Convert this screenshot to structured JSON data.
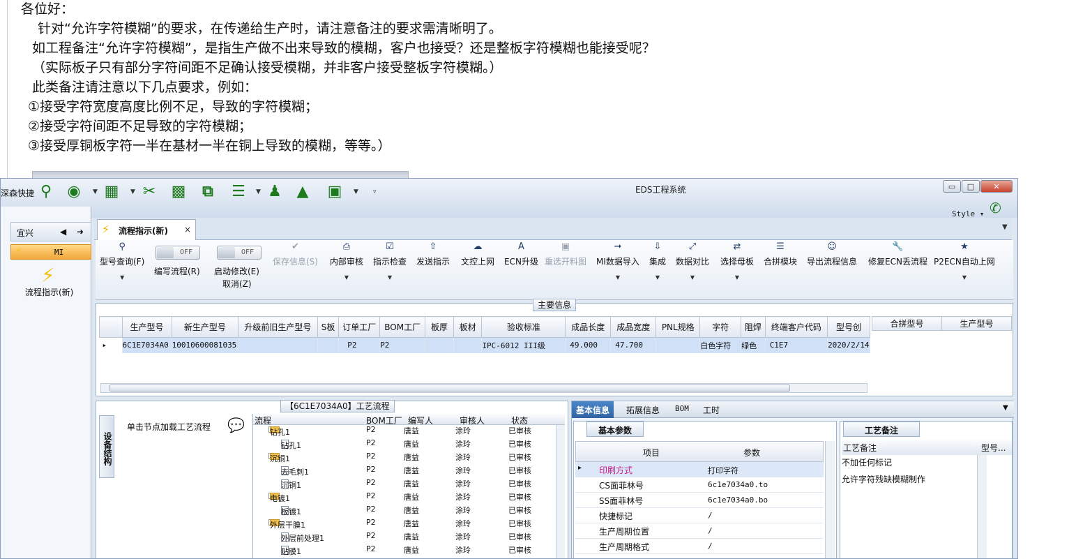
{
  "email": {
    "lines": [
      "各位好：",
      "针对“允许字符模糊”的要求，在传递给生产时，请注意备注的要求需清晰明了。",
      "如工程备注“允许字符模糊”，是指生产做不出来导致的模糊，客户也接受？还是整板字符模糊也能接受呢？",
      "（实际板子只有部分字符间距不足确认接受模糊，并非客户接受整板字符模糊。）",
      "此类备注请注意以下几点要求，例如：",
      "①接受字符宽度高度比例不足，导致的字符模糊；",
      "②接受字符间距不足导致的字符模糊；",
      "③接受厚铜板字符一半在基材一半在铜上导致的模糊，等等。）"
    ]
  },
  "window": {
    "title": "EDS工程系统",
    "quick_access_label": "深森快捷",
    "style_label": "Style",
    "controls": {
      "minimize": "▭",
      "restore": "□",
      "close": "✕"
    }
  },
  "left_nav": {
    "header": "宜兴",
    "group": "MI",
    "item_label": "流程指示(新)"
  },
  "doc_tab": {
    "label": "流程指示(新)",
    "close": "×"
  },
  "toolbar": {
    "model_query": "型号查询(F)",
    "write_flow": "编写流程(R)",
    "start_modify": "启动修改(E)",
    "cancel": "取消(Z)",
    "toggle_off": "OFF",
    "save_info": "保存信息(S)",
    "internal_review": "内部审核",
    "instr_check": "指示检查",
    "send_instr": "发送指示",
    "doc_upload": "文控上网",
    "ecn_upgrade": "ECN升级",
    "reselect_cut": "重选开料图",
    "mi_import": "MI数据导入",
    "integrate": "集成",
    "data_compare": "数据对比",
    "select_mother": "选择母板",
    "combine_module": "合拼模块",
    "export_flow": "导出流程信息",
    "fix_ecn": "修复ECN丢流程",
    "p2ecn": "P2ECN自动上网"
  },
  "main_info": {
    "caption": "主要信息",
    "columns": [
      "生产型号",
      "新生产型号",
      "升级前旧生产型号",
      "S板",
      "订单工厂",
      "BOM工厂",
      "板厚",
      "板材",
      "验收标准",
      "成品长度",
      "成品宽度",
      "PNL规格",
      "字符",
      "阻焊",
      "终端客户代码",
      "型号创"
    ],
    "row": [
      "6C1E7034A0",
      "10010600081035",
      "",
      "",
      "P2",
      "P2",
      "",
      "",
      "IPC-6012 III级",
      "49.000",
      "47.700",
      "",
      "白色字符",
      "绿色",
      "C1E7",
      "2020/2/14"
    ],
    "side_columns": [
      "合拼型号",
      "生产型号"
    ]
  },
  "process": {
    "caption": "【6C1E7034A0】工艺流程",
    "side_tab": "设备结构",
    "click_hint": "单击节点加载工艺流程",
    "columns": [
      "流程",
      "BOM工厂",
      "编写人",
      "审核人",
      "状态"
    ],
    "rows": [
      {
        "name": "钻孔1",
        "kind": "folder",
        "bom": "P2",
        "writer": "唐益",
        "reviewer": "涂玲",
        "status": "已审核"
      },
      {
        "name": "钻孔1",
        "kind": "file",
        "bom": "P2",
        "writer": "唐益",
        "reviewer": "涂玲",
        "status": "已审核"
      },
      {
        "name": "沉铜1",
        "kind": "folder",
        "bom": "P2",
        "writer": "唐益",
        "reviewer": "涂玲",
        "status": "已审核"
      },
      {
        "name": "去毛刺1",
        "kind": "file",
        "bom": "P2",
        "writer": "唐益",
        "reviewer": "涂玲",
        "status": "已审核"
      },
      {
        "name": "沉铜1",
        "kind": "file",
        "bom": "P2",
        "writer": "唐益",
        "reviewer": "涂玲",
        "status": "已审核"
      },
      {
        "name": "电镀1",
        "kind": "folder",
        "bom": "P2",
        "writer": "唐益",
        "reviewer": "涂玲",
        "status": "已审核"
      },
      {
        "name": "板镀1",
        "kind": "file",
        "bom": "P2",
        "writer": "唐益",
        "reviewer": "涂玲",
        "status": "已审核"
      },
      {
        "name": "外层干膜1",
        "kind": "folder",
        "bom": "P2",
        "writer": "唐益",
        "reviewer": "涂玲",
        "status": "已审核"
      },
      {
        "name": "外层前处理1",
        "kind": "file",
        "bom": "P2",
        "writer": "唐益",
        "reviewer": "涂玲",
        "status": "已审核"
      },
      {
        "name": "贴膜1",
        "kind": "file",
        "bom": "P2",
        "writer": "唐益",
        "reviewer": "涂玲",
        "status": "已审核"
      }
    ]
  },
  "detail": {
    "tabs": [
      "基本信息",
      "拓展信息",
      "BOM",
      "工时"
    ],
    "params_tab": "基本参数",
    "param_headers": [
      "项目",
      "参数"
    ],
    "params": [
      {
        "item": "印刷方式",
        "value": "打印字符"
      },
      {
        "item": "CS面菲林号",
        "value": "6c1e7034a0.to"
      },
      {
        "item": "SS面菲林号",
        "value": "6c1e7034a0.bo"
      },
      {
        "item": "快捷标记",
        "value": "/"
      },
      {
        "item": "生产周期位置",
        "value": "/"
      },
      {
        "item": "生产周期格式",
        "value": "/"
      }
    ],
    "notes_tab": "工艺备注",
    "notes_headers": [
      "工艺备注",
      "型号..."
    ],
    "notes": [
      "不加任何标记",
      "允许字符残缺模糊制作"
    ]
  },
  "colors": {
    "accent": "#2f63a4",
    "selected_row": "#cfe0f7",
    "icon_green": "#1d7a1d",
    "mi_orange": "#f3a63a"
  }
}
